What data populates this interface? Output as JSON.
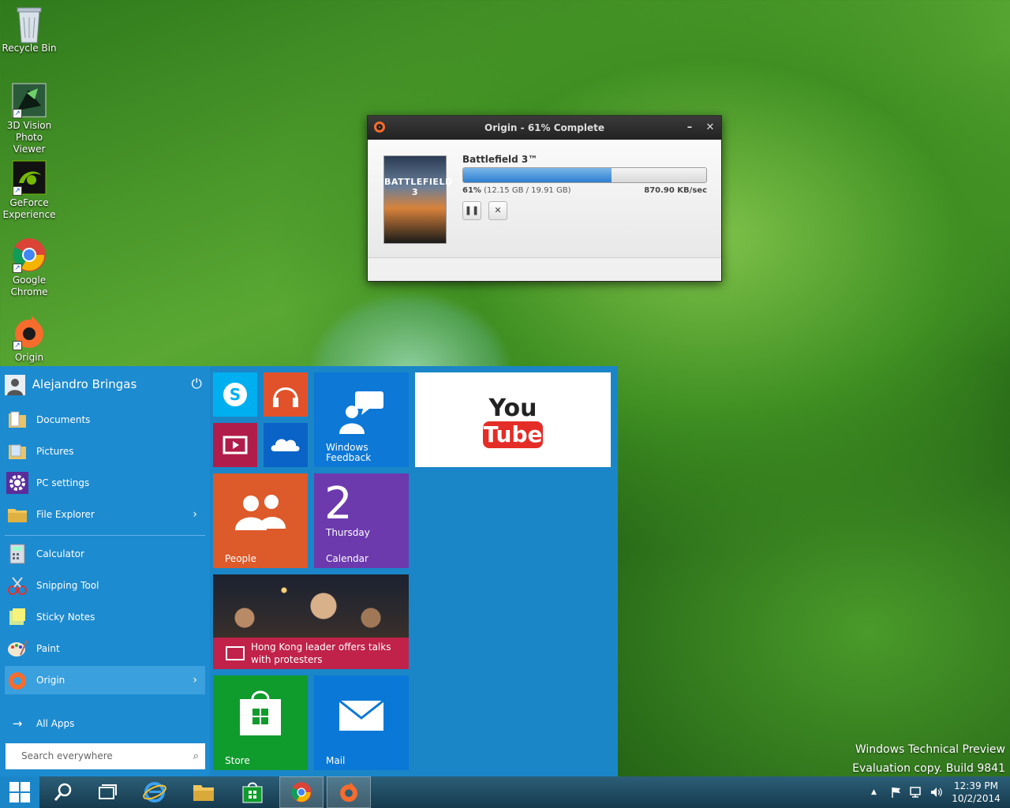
{
  "desktop": {
    "icons": [
      {
        "label": "Recycle Bin"
      },
      {
        "label": "3D Vision Photo Viewer"
      },
      {
        "label": "GeForce Experience"
      },
      {
        "label": "Google Chrome"
      },
      {
        "label": "Origin"
      }
    ],
    "watermark_line1": "Windows Technical Preview",
    "watermark_line2": "Evaluation copy. Build 9841"
  },
  "origin_window": {
    "title": "Origin - 61% Complete",
    "minimize": "–",
    "close": "✕",
    "cover_text": "BATTLEFIELD 3",
    "game_title": "Battlefield 3™",
    "progress": 0.61,
    "percent": "61%",
    "size_text": "(12.15 GB / 19.91 GB)",
    "speed": "870.90 KB/sec",
    "pause": "❚❚",
    "cancel": "✕"
  },
  "start_menu": {
    "user_name": "Alejandro Bringas",
    "power": "⏻",
    "items": [
      {
        "label": "Documents"
      },
      {
        "label": "Pictures"
      },
      {
        "label": "PC settings"
      },
      {
        "label": "File Explorer",
        "arrow": "›"
      },
      {
        "label": "Calculator"
      },
      {
        "label": "Snipping Tool"
      },
      {
        "label": "Sticky Notes"
      },
      {
        "label": "Paint"
      },
      {
        "label": "Origin",
        "arrow": "›"
      }
    ],
    "all_apps_arrow": "→",
    "all_apps": "All Apps",
    "search_placeholder": "Search everywhere",
    "search_icon": "⌕",
    "tiles": {
      "windows_feedback": "Windows Feedback",
      "youtube_you": "You",
      "youtube_tube": "Tube",
      "people": "People",
      "calendar_day": "2",
      "calendar_weekday": "Thursday",
      "calendar": "Calendar",
      "news_headline": "Hong Kong leader offers talks with protesters",
      "store": "Store",
      "mail": "Mail"
    }
  },
  "taskbar": {
    "clock_time": "12:39 PM",
    "clock_date": "10/2/2014",
    "tray_up": "▲"
  },
  "colors": {
    "start_bg": "#1a86c8",
    "skype": "#00aff0",
    "music": "#e1522b",
    "video": "#b01d4a",
    "onedrive": "#0a63c6",
    "feedback": "#0d78d6",
    "people": "#dd5a2a",
    "calendar": "#6c3aad",
    "news": "#c0224a",
    "store": "#109b2d",
    "mail": "#0a78d6"
  }
}
